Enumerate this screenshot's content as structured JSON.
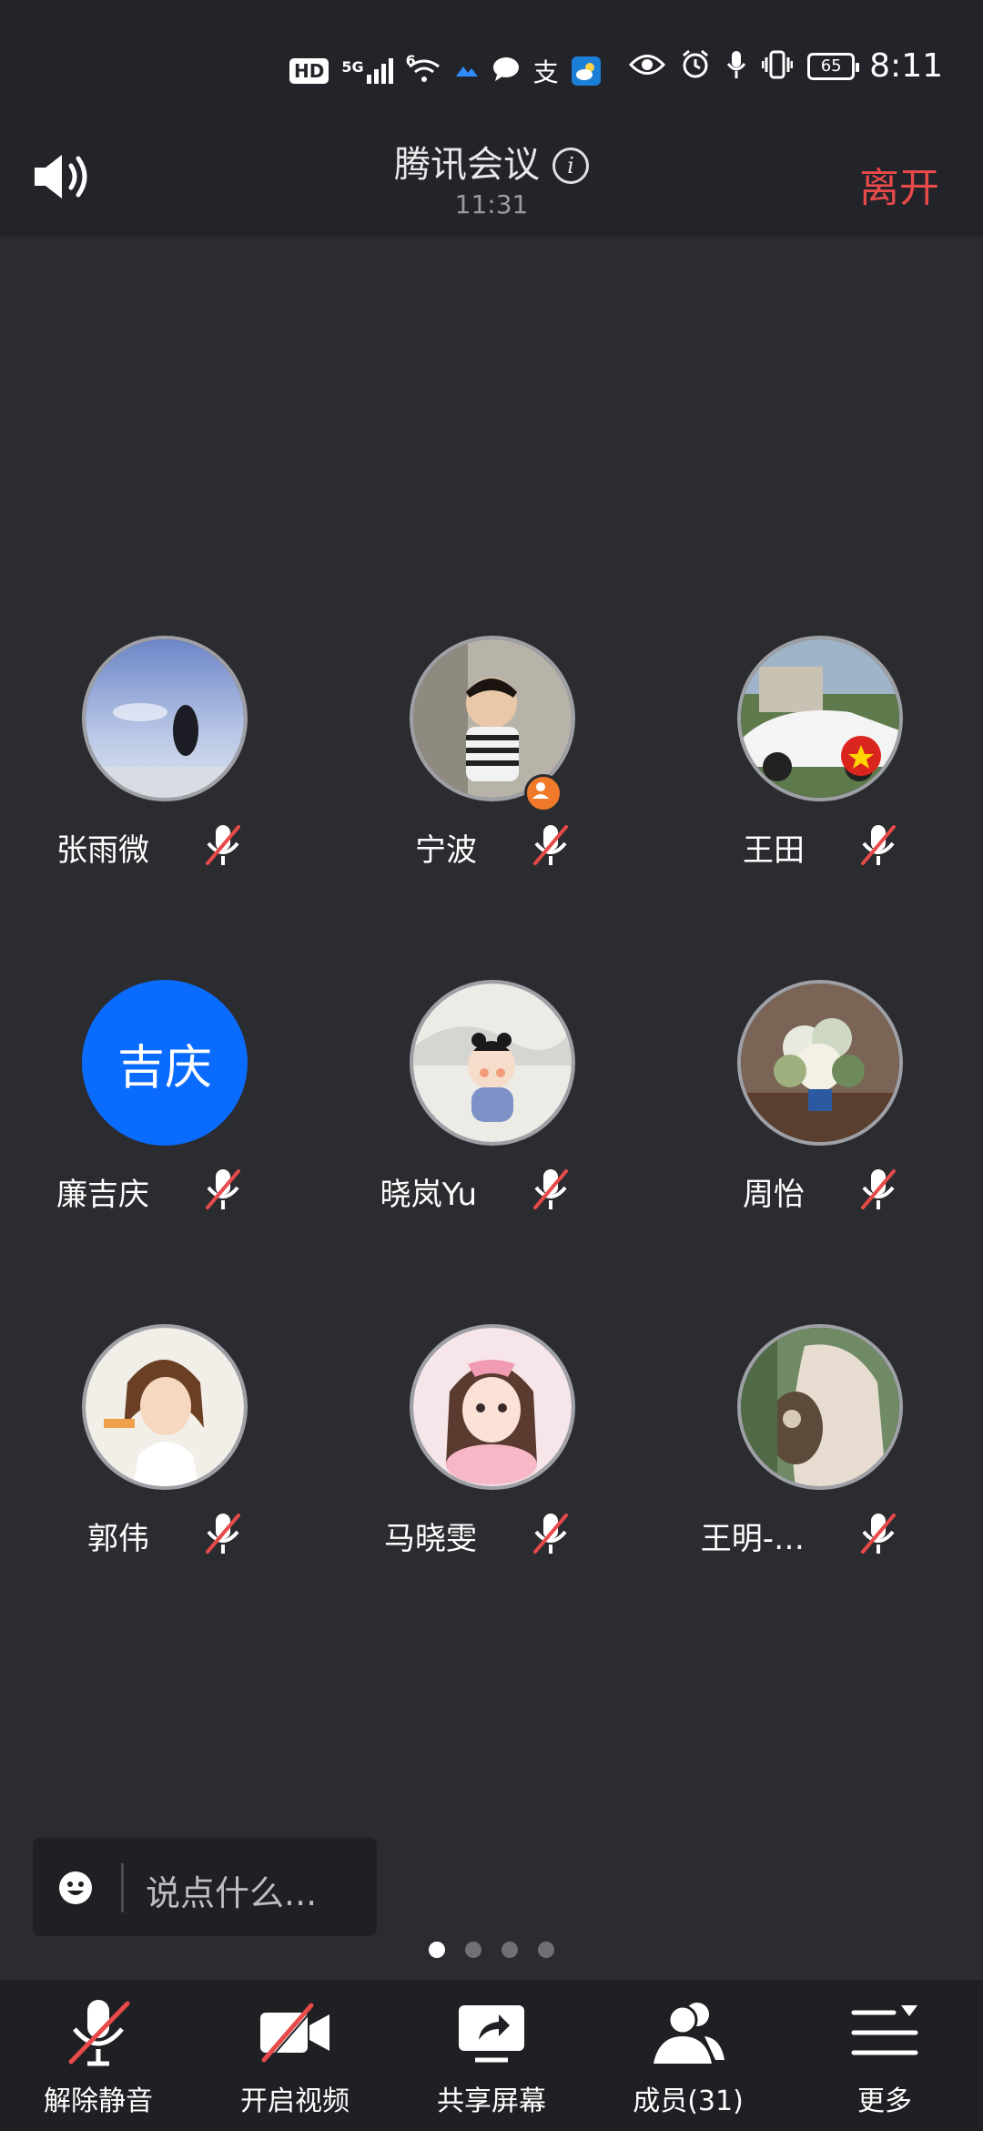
{
  "status_bar": {
    "left_icons": [
      "hd-icon",
      "5g-signal-icon",
      "wifi-6-icon",
      "app-icon",
      "message-icon",
      "alipay-icon",
      "weather-icon"
    ],
    "hd": "HD",
    "net": "5G",
    "wifi": "6",
    "right_icons": [
      "eye-icon",
      "alarm-icon",
      "mic-icon",
      "vibrate-icon"
    ],
    "battery": "65",
    "time": "8:11"
  },
  "header": {
    "title": "腾讯会议",
    "duration": "11:31",
    "leave_label": "离开",
    "leave_color": "#e84a4a"
  },
  "participants": [
    {
      "name": "张雨微",
      "avatar": "photo-avatar",
      "muted": true
    },
    {
      "name": "宁波",
      "avatar": "photo-avatar",
      "muted": true,
      "host": true
    },
    {
      "name": "王田",
      "avatar": "photo-avatar",
      "muted": true
    },
    {
      "name": "廉吉庆",
      "avatar_text": "吉庆",
      "muted": true
    },
    {
      "name": "晓岚Yu",
      "avatar": "photo-avatar",
      "muted": true
    },
    {
      "name": "周怡",
      "avatar": "photo-avatar",
      "muted": true
    },
    {
      "name": "郭伟",
      "avatar": "photo-avatar",
      "muted": true
    },
    {
      "name": "马晓雯",
      "avatar": "photo-avatar",
      "muted": true
    },
    {
      "name": "王明-…",
      "avatar": "photo-avatar",
      "muted": true
    }
  ],
  "chat": {
    "placeholder": "说点什么..."
  },
  "pager": {
    "pages": 4,
    "current": 1
  },
  "toolbar": {
    "unmute": "解除静音",
    "video": "开启视频",
    "share": "共享屏幕",
    "members": "成员(31)",
    "more": "更多"
  },
  "colors": {
    "background": "#2b2c30",
    "bar": "#23242a",
    "accent_blue": "#0a6cff",
    "mute_red": "#e84a4a"
  }
}
